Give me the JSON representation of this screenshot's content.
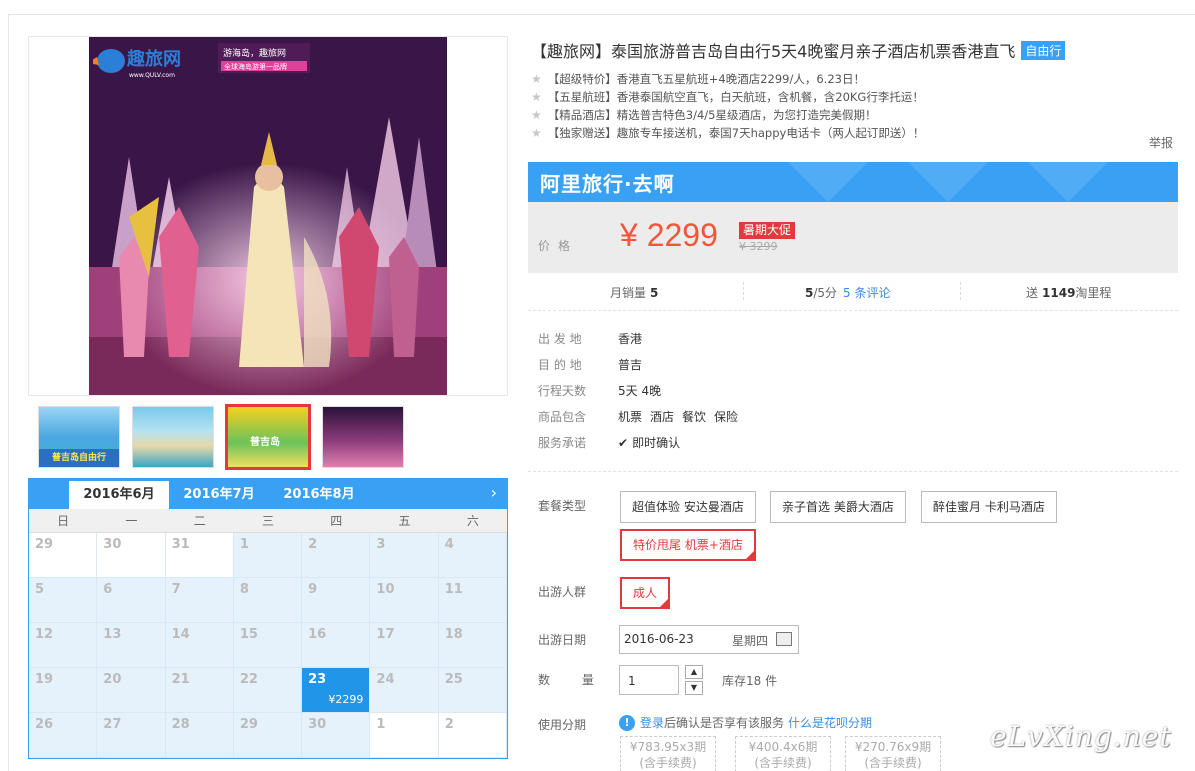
{
  "product": {
    "title": "【趣旅网】泰国旅游普吉岛自由行5天4晚蜜月亲子酒店机票香港直飞",
    "badge": "自由行",
    "promos": [
      "【超级特价】香港直飞五星航班+4晚酒店2299/人，6.23日！",
      "【五星航班】香港泰国航空直飞，白天航班，含机餐，含20KG行李托运！",
      "【精品酒店】精选普吉特色3/4/5星级酒店，为您打造完美假期！",
      "【独家赠送】趣旅专车接送机，泰国7天happy电话卡（两人起订即送）！"
    ],
    "report": "举报"
  },
  "gallery": {
    "logo_text": "趣旅网",
    "logo_sub": "www.QULV.com",
    "logo_slogan": "游海岛，趣旅网",
    "logo_slogan2": "全球海岛游第一品牌",
    "thumb1_caption": "普吉岛自由行",
    "thumb3_caption": "普吉岛"
  },
  "calendar": {
    "tabs": [
      "2016年6月",
      "2016年7月",
      "2016年8月"
    ],
    "next": "›",
    "weekdays": [
      "日",
      "一",
      "二",
      "三",
      "四",
      "五",
      "六"
    ],
    "days": [
      {
        "d": "29",
        "s": "off"
      },
      {
        "d": "30",
        "s": "off"
      },
      {
        "d": "31",
        "s": "off"
      },
      {
        "d": "1",
        "s": "avail"
      },
      {
        "d": "2",
        "s": "avail"
      },
      {
        "d": "3",
        "s": "avail"
      },
      {
        "d": "4",
        "s": "avail"
      },
      {
        "d": "5",
        "s": "avail"
      },
      {
        "d": "6",
        "s": "avail"
      },
      {
        "d": "7",
        "s": "avail"
      },
      {
        "d": "8",
        "s": "avail"
      },
      {
        "d": "9",
        "s": "avail"
      },
      {
        "d": "10",
        "s": "avail"
      },
      {
        "d": "11",
        "s": "avail"
      },
      {
        "d": "12",
        "s": "avail"
      },
      {
        "d": "13",
        "s": "avail"
      },
      {
        "d": "14",
        "s": "avail"
      },
      {
        "d": "15",
        "s": "avail"
      },
      {
        "d": "16",
        "s": "avail"
      },
      {
        "d": "17",
        "s": "avail"
      },
      {
        "d": "18",
        "s": "avail"
      },
      {
        "d": "19",
        "s": "avail"
      },
      {
        "d": "20",
        "s": "avail"
      },
      {
        "d": "21",
        "s": "avail"
      },
      {
        "d": "22",
        "s": "avail"
      },
      {
        "d": "23",
        "s": "sel",
        "p": "¥2299"
      },
      {
        "d": "24",
        "s": "avail"
      },
      {
        "d": "25",
        "s": "avail"
      },
      {
        "d": "26",
        "s": "avail"
      },
      {
        "d": "27",
        "s": "avail"
      },
      {
        "d": "28",
        "s": "avail"
      },
      {
        "d": "29",
        "s": "avail"
      },
      {
        "d": "30",
        "s": "avail"
      },
      {
        "d": "1",
        "s": "off"
      },
      {
        "d": "2",
        "s": "off"
      }
    ]
  },
  "price": {
    "brand": "阿里旅行·去啊",
    "label": "价格",
    "value": "¥ 2299",
    "promo_badge": "暑期大促",
    "old": "¥ 3299"
  },
  "stats": {
    "sales_label": "月销量",
    "sales_value": "5",
    "rating_value": "5",
    "rating_max": "/5分",
    "reviews_link": "5 条评论",
    "points_prefix": "送",
    "points_value": "1149",
    "points_suffix": "淘里程"
  },
  "info": {
    "rows": [
      {
        "k": "出 发 地",
        "v": "香港"
      },
      {
        "k": "目 的 地",
        "v": "普吉"
      },
      {
        "k": "行程天数",
        "v": "5天 4晚"
      }
    ],
    "includes_label": "商品包含",
    "includes": [
      "机票",
      "酒店",
      "餐饮",
      "保险"
    ],
    "service_label": "服务承诺",
    "service_value": "即时确认"
  },
  "options": {
    "package_label": "套餐类型",
    "packages": [
      "超值体验 安达曼酒店",
      "亲子首选 美爵大酒店",
      "醉佳蜜月 卡利马酒店",
      "特价甩尾 机票+酒店"
    ],
    "people_label": "出游人群",
    "people": "成人",
    "date_label": "出游日期",
    "date_value": "2016-06-23",
    "date_weekday": "星期四",
    "qty_label": "数 量",
    "qty_value": "1",
    "stock": "库存18 件",
    "fq_label": "使用分期",
    "fq_login": "登录",
    "fq_text": "后确认是否享有该服务",
    "fq_link": "什么是花呗分期",
    "fq_plans": [
      {
        "amt": "¥783.95x3期",
        "fee": "(含手续费)"
      },
      {
        "amt": "¥400.4x6期",
        "fee": "(含手续费)"
      },
      {
        "amt": "¥270.76x9期",
        "fee": "(含手续费)"
      }
    ]
  },
  "watermark": "eLvXing.net",
  "colors": {
    "accent": "#39a1f4",
    "price": "#f5553a",
    "selected": "#e4393c"
  }
}
